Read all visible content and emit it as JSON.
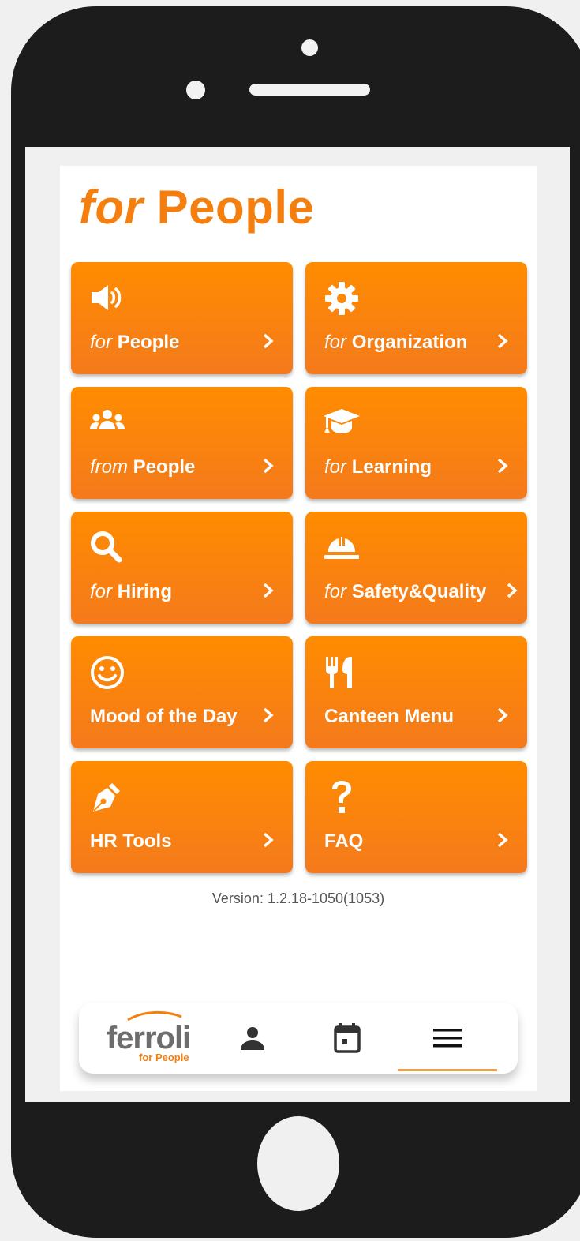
{
  "app": {
    "title_prefix": "for",
    "title_main": "People",
    "accent": "#f47f0f"
  },
  "tiles": [
    {
      "prefix": "for",
      "label": "People",
      "icon": "megaphone-icon"
    },
    {
      "prefix": "for",
      "label": "Organization",
      "icon": "gear-icon"
    },
    {
      "prefix": "from",
      "label": "People",
      "icon": "users-icon"
    },
    {
      "prefix": "for",
      "label": "Learning",
      "icon": "graduation-cap-icon"
    },
    {
      "prefix": "for",
      "label": "Hiring",
      "icon": "search-icon"
    },
    {
      "prefix": "for",
      "label": "Safety&Quality",
      "icon": "hard-hat-icon"
    },
    {
      "label": "Mood of the Day",
      "icon": "smiley-icon"
    },
    {
      "label": "Canteen Menu",
      "icon": "cutlery-icon"
    },
    {
      "label": "HR Tools",
      "icon": "pen-icon"
    },
    {
      "label": "FAQ",
      "icon": "question-icon"
    }
  ],
  "version": {
    "label": "Version:",
    "value": "1.2.18-1050(1053)"
  },
  "nav": {
    "logo_text": "ferroli",
    "logo_sub": "for People",
    "items": [
      "logo",
      "profile-icon",
      "calendar-icon",
      "menu-icon"
    ],
    "active": "menu-icon"
  }
}
